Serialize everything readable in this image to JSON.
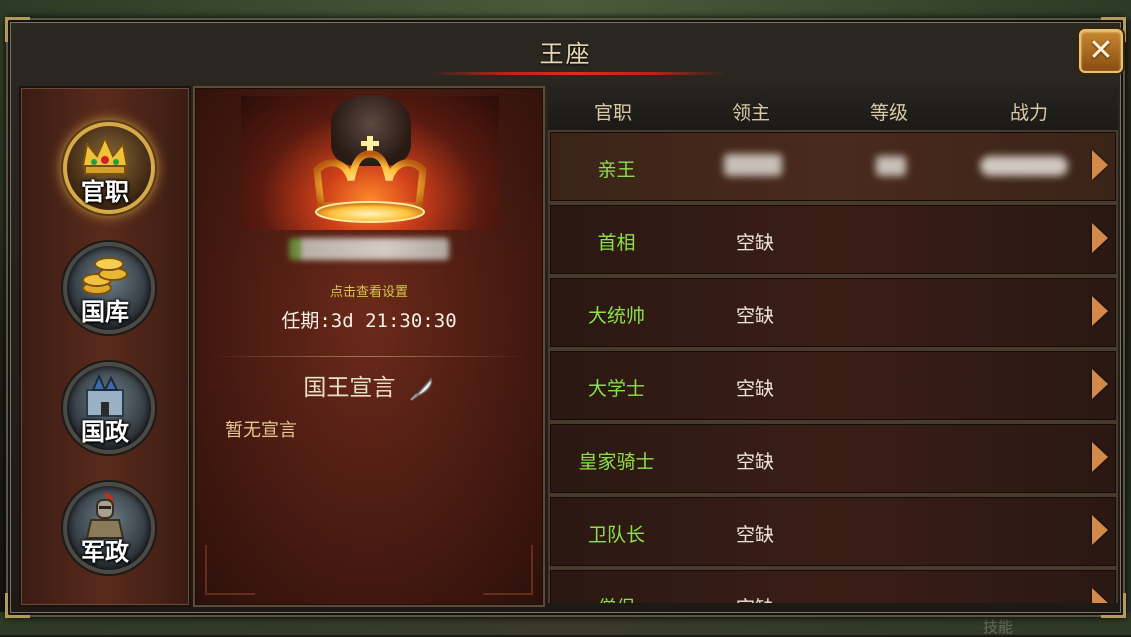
{
  "window": {
    "title": "王座",
    "close_label": "✕"
  },
  "nav": {
    "items": [
      {
        "label": "官职",
        "icon": "crown-icon",
        "active": true
      },
      {
        "label": "国库",
        "icon": "gold-coins-icon",
        "active": false
      },
      {
        "label": "国政",
        "icon": "castle-icon",
        "active": false
      },
      {
        "label": "军政",
        "icon": "knight-icon",
        "active": false
      }
    ]
  },
  "king": {
    "settings_link": "点击查看设置",
    "term": "任期:3d 21:30:30",
    "declaration_title": "国王宣言",
    "declaration_text": "暂无宣言"
  },
  "table": {
    "headers": [
      "官职",
      "领主",
      "等级",
      "战力"
    ],
    "rows": [
      {
        "title": "亲王",
        "lord": ""
      },
      {
        "title": "首相",
        "lord": "空缺"
      },
      {
        "title": "大统帅",
        "lord": "空缺"
      },
      {
        "title": "大学士",
        "lord": "空缺"
      },
      {
        "title": "皇家骑士",
        "lord": "空缺"
      },
      {
        "title": "卫队长",
        "lord": "空缺"
      },
      {
        "title": "僧侣",
        "lord": "空缺"
      }
    ]
  },
  "background_hint": "技能",
  "colors": {
    "title_green": "#8de04a",
    "accent_red": "#d8301c",
    "gold": "#d6a94a"
  }
}
